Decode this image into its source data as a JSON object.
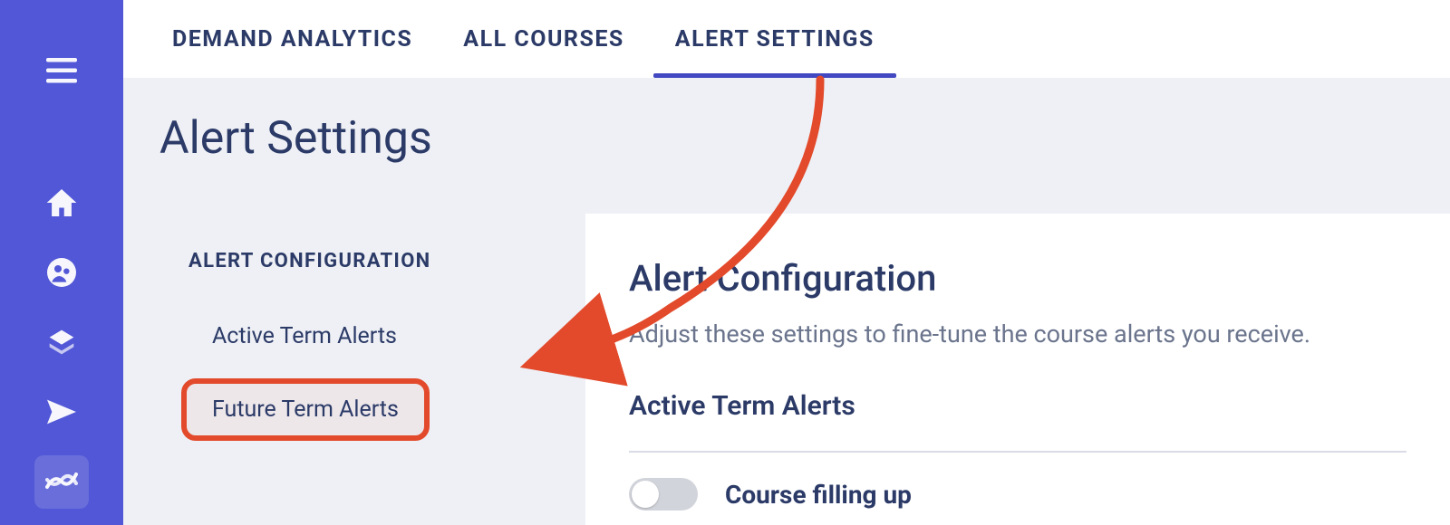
{
  "tabs": {
    "demand": "DEMAND ANALYTICS",
    "courses": "ALL COURSES",
    "alerts": "ALERT SETTINGS"
  },
  "page": {
    "title": "Alert Settings"
  },
  "subnav": {
    "heading": "ALERT CONFIGURATION",
    "items": {
      "active": "Active Term Alerts",
      "future": "Future Term Alerts"
    }
  },
  "card": {
    "title": "Alert Configuration",
    "subtitle": "Adjust these settings to fine-tune the course alerts you receive.",
    "section_title": "Active Term Alerts",
    "settings": {
      "course_filling": {
        "label": "Course filling up",
        "enabled": false
      }
    }
  }
}
